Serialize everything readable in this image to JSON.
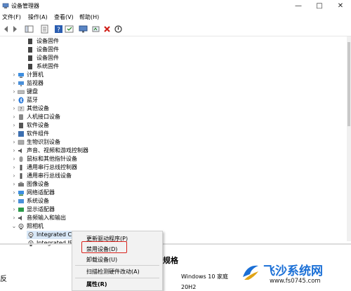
{
  "window": {
    "title": "设备管理器",
    "minimize": "—",
    "maximize": "□",
    "close": "✕"
  },
  "menu": {
    "items": [
      "文件(F)",
      "操作(A)",
      "查看(V)",
      "帮助(H)"
    ]
  },
  "tree": {
    "firmware_items": [
      "设备固件",
      "设备固件",
      "设备固件",
      "系统固件"
    ],
    "categories": [
      "计算机",
      "监视器",
      "键盘",
      "蓝牙",
      "其他设备",
      "人机接口设备",
      "软件设备",
      "软件组件",
      "生物识别设备",
      "声音、视频和游戏控制器",
      "鼠标和其他指针设备",
      "通用串行总线控制器",
      "通用串行总线设备",
      "图像设备",
      "网络适配器",
      "系统设备",
      "显示适配器",
      "音频输入和输出",
      "照相机"
    ],
    "camera_children": [
      "Integrated Camera",
      "Integrated IR C"
    ]
  },
  "context_menu": {
    "items": [
      "更新驱动程序(P)",
      "禁用设备(D)",
      "卸载设备(U)",
      "扫描检测硬件改动(A)",
      "属性(R)"
    ]
  },
  "background": {
    "left_frag": "反",
    "right_frag": "规格",
    "os_line1": "Windows 10 家庭",
    "os_line2": "20H2"
  },
  "watermark": {
    "brand": "飞沙系统网",
    "url": "www.fs0745.com"
  },
  "colors": {
    "highlight": "#d9231d",
    "accent": "#1a6fd6"
  }
}
